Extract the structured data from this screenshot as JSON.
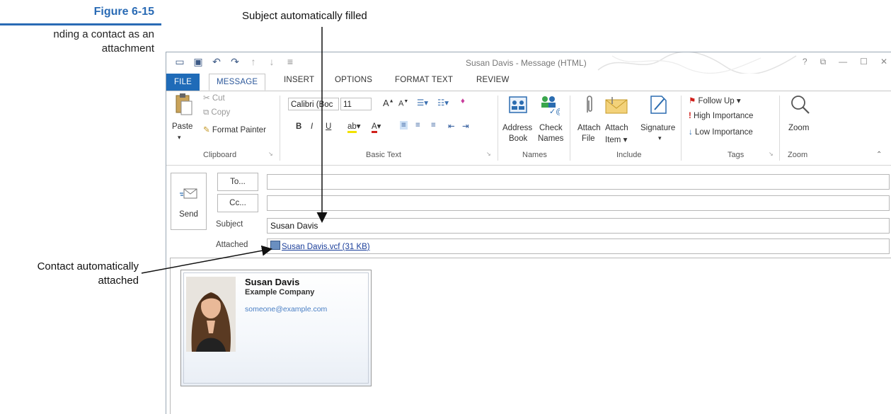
{
  "figure": {
    "number": "Figure 6-15",
    "caption_lines": [
      "nding a contact as an",
      "attachment"
    ]
  },
  "callouts": {
    "subject": "Subject automatically filled",
    "contact_line1": "Contact automatically",
    "contact_line2": "attached"
  },
  "window": {
    "title": "Susan Davis - Message (HTML)",
    "controls": [
      "?",
      "⧉",
      "—",
      "☐",
      "✕"
    ]
  },
  "tabs": [
    "FILE",
    "MESSAGE",
    "INSERT",
    "OPTIONS",
    "FORMAT TEXT",
    "REVIEW"
  ],
  "ribbon": {
    "clipboard": {
      "paste": "Paste",
      "cut": "Cut",
      "copy": "Copy",
      "format_painter": "Format Painter",
      "label": "Clipboard"
    },
    "basic_text": {
      "font": "Calibri (Boc",
      "size": "11",
      "label": "Basic Text"
    },
    "names": {
      "address_book_1": "Address",
      "address_book_2": "Book",
      "check_names_1": "Check",
      "check_names_2": "Names",
      "label": "Names"
    },
    "include": {
      "attach_file_1": "Attach",
      "attach_file_2": "File",
      "attach_item_1": "Attach",
      "attach_item_2": "Item",
      "signature": "Signature",
      "label": "Include"
    },
    "tags": {
      "follow_up": "Follow Up",
      "high": "High Importance",
      "low": "Low Importance",
      "label": "Tags"
    },
    "zoom": {
      "button": "Zoom",
      "label": "Zoom"
    }
  },
  "message": {
    "send": "Send",
    "to_button": "To...",
    "cc_button": "Cc...",
    "subject_label": "Subject",
    "subject_value": "Susan Davis",
    "attached_label": "Attached",
    "attachment": "Susan Davis.vcf (31 KB)"
  },
  "card": {
    "name": "Susan Davis",
    "company": "Example Company",
    "email": "someone@example.com"
  },
  "colors": {
    "accent": "#2a6bb5",
    "file_tab": "#1f6bb8",
    "link": "#1a3e9a"
  }
}
